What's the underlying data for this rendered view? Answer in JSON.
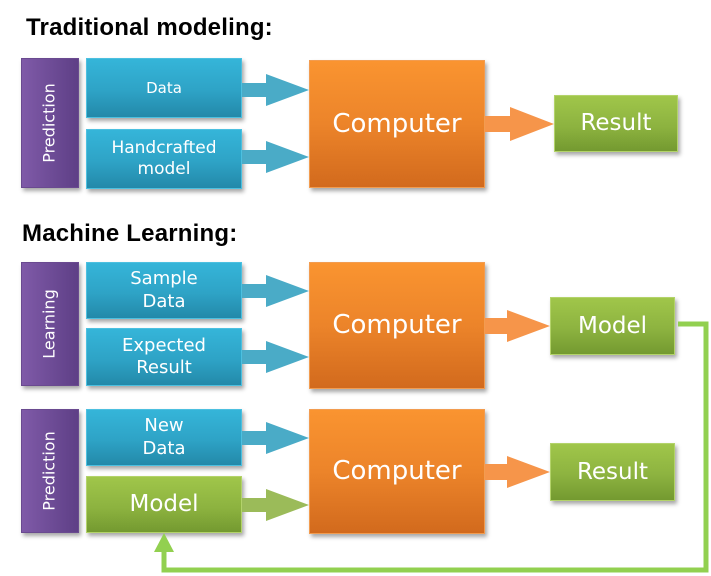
{
  "sections": {
    "traditional": {
      "title": "Traditional modeling:",
      "phase": "Prediction",
      "inputs": [
        "Data",
        "Handcrafted model"
      ],
      "processor": "Computer",
      "output": "Result"
    },
    "ml": {
      "title": "Machine Learning:",
      "learning": {
        "phase": "Learning",
        "inputs": [
          "Sample Data",
          "Expected Result"
        ],
        "processor": "Computer",
        "output": "Model"
      },
      "prediction": {
        "phase": "Prediction",
        "inputs": [
          "New Data",
          "Model"
        ],
        "processor": "Computer",
        "output": "Result"
      }
    }
  },
  "colors": {
    "phase": "#6d4c97",
    "input": "#31acd0",
    "processor": "#f08a2c",
    "output": "#8db340",
    "feedback": "#92d050"
  }
}
